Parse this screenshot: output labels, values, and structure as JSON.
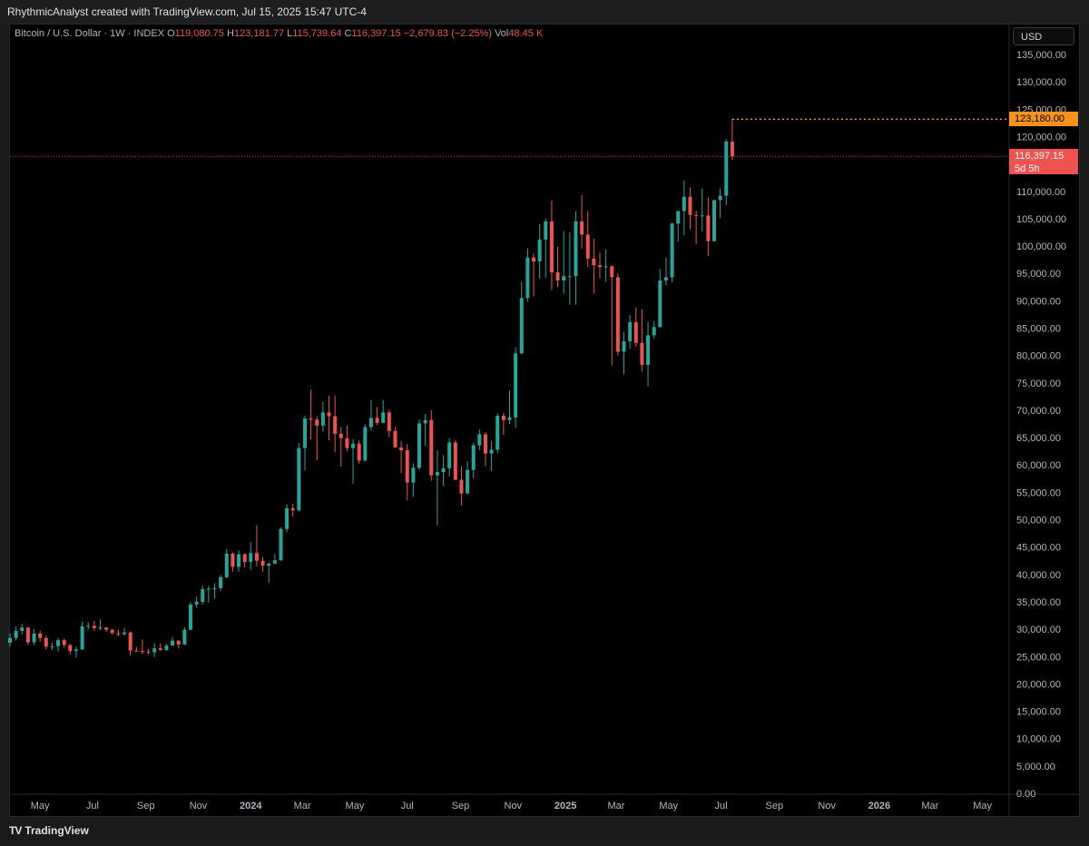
{
  "header": {
    "attribution": "RhythmicAnalyst created with TradingView.com, Jul 15, 2025 15:47 UTC-4"
  },
  "legend": {
    "symbol": "Bitcoin / U.S. Dollar · 1W · INDEX",
    "open_key": "O",
    "open": "119,080.75",
    "high_key": "H",
    "high": "123,181.77",
    "low_key": "L",
    "low": "115,739.64",
    "close_key": "C",
    "close": "116,397.15",
    "change": "−2,679.83 (−2.25%)",
    "vol_key": "Vol",
    "vol": "48.45 K"
  },
  "currency": "USD",
  "high_label": "123,180.00",
  "last_price_label": "116,397.15",
  "countdown_label": "5d 5h",
  "brand": "TradingView",
  "colors": {
    "up": "#26a69a",
    "down": "#ef5350",
    "high_line": "#f7931a",
    "last_line": "#ef5350"
  },
  "chart_data": {
    "type": "candlestick",
    "interval": "1W",
    "ylim": [
      0,
      137000
    ],
    "y_ticks": [
      "0.00",
      "5,000.00",
      "10,000.00",
      "15,000.00",
      "20,000.00",
      "25,000.00",
      "30,000.00",
      "35,000.00",
      "40,000.00",
      "45,000.00",
      "50,000.00",
      "55,000.00",
      "60,000.00",
      "65,000.00",
      "70,000.00",
      "75,000.00",
      "80,000.00",
      "85,000.00",
      "90,000.00",
      "95,000.00",
      "100,000.00",
      "105,000.00",
      "110,000.00",
      "115,000.00",
      "120,000.00",
      "125,000.00",
      "130,000.00",
      "135,000.00"
    ],
    "x_ticks": [
      {
        "label": "May",
        "date": "2023-05-01"
      },
      {
        "label": "Jul",
        "date": "2023-07-01"
      },
      {
        "label": "Sep",
        "date": "2023-09-01"
      },
      {
        "label": "Nov",
        "date": "2023-11-01"
      },
      {
        "label": "2024",
        "date": "2024-01-01",
        "bold": true
      },
      {
        "label": "Mar",
        "date": "2024-03-01"
      },
      {
        "label": "May",
        "date": "2024-05-01"
      },
      {
        "label": "Jul",
        "date": "2024-07-01"
      },
      {
        "label": "Sep",
        "date": "2024-09-01"
      },
      {
        "label": "Nov",
        "date": "2024-11-01"
      },
      {
        "label": "2025",
        "date": "2025-01-01",
        "bold": true
      },
      {
        "label": "Mar",
        "date": "2025-03-01"
      },
      {
        "label": "May",
        "date": "2025-05-01"
      },
      {
        "label": "Jul",
        "date": "2025-07-01"
      },
      {
        "label": "Sep",
        "date": "2025-09-01"
      },
      {
        "label": "Nov",
        "date": "2025-11-01"
      },
      {
        "label": "2026",
        "date": "2026-01-01",
        "bold": true
      },
      {
        "label": "Mar",
        "date": "2026-03-01"
      },
      {
        "label": "May",
        "date": "2026-05-01"
      }
    ],
    "high_marker": 123181.77,
    "last_price": 116397.15,
    "ohlc": [
      [
        "2023-03-27",
        27500,
        29200,
        26800,
        28400
      ],
      [
        "2023-04-03",
        28400,
        30500,
        27900,
        29700
      ],
      [
        "2023-04-10",
        29700,
        31000,
        29000,
        30300
      ],
      [
        "2023-04-17",
        30300,
        30400,
        27200,
        27600
      ],
      [
        "2023-04-24",
        27600,
        30000,
        27100,
        29200
      ],
      [
        "2023-05-01",
        29200,
        29700,
        27700,
        28400
      ],
      [
        "2023-05-08",
        28400,
        28800,
        26300,
        26800
      ],
      [
        "2023-05-15",
        26800,
        27500,
        26200,
        26900
      ],
      [
        "2023-05-22",
        26900,
        28400,
        25900,
        28000
      ],
      [
        "2023-05-29",
        28000,
        28300,
        26600,
        27100
      ],
      [
        "2023-06-05",
        27100,
        27300,
        25400,
        26000
      ],
      [
        "2023-06-12",
        26000,
        26800,
        24800,
        26300
      ],
      [
        "2023-06-19",
        26300,
        31400,
        26200,
        30500
      ],
      [
        "2023-06-26",
        30500,
        31300,
        29900,
        30600
      ],
      [
        "2023-07-03",
        30600,
        31500,
        29700,
        30200
      ],
      [
        "2023-07-10",
        30200,
        31800,
        29800,
        30300
      ],
      [
        "2023-07-17",
        30300,
        30400,
        29500,
        29900
      ],
      [
        "2023-07-24",
        29900,
        30000,
        29000,
        29300
      ],
      [
        "2023-07-31",
        29300,
        29900,
        28700,
        29100
      ],
      [
        "2023-08-07",
        29100,
        30200,
        28800,
        29400
      ],
      [
        "2023-08-14",
        29400,
        29600,
        25200,
        26100
      ],
      [
        "2023-08-21",
        26100,
        26800,
        25800,
        26000
      ],
      [
        "2023-08-28",
        26000,
        28100,
        25400,
        25900
      ],
      [
        "2023-09-04",
        25900,
        26400,
        25400,
        25800
      ],
      [
        "2023-09-11",
        25800,
        27400,
        24900,
        26500
      ],
      [
        "2023-09-18",
        26500,
        27400,
        26000,
        26200
      ],
      [
        "2023-09-25",
        26200,
        27300,
        26000,
        27000
      ],
      [
        "2023-10-02",
        27000,
        28600,
        27200,
        27900
      ],
      [
        "2023-10-09",
        27900,
        28000,
        26500,
        27200
      ],
      [
        "2023-10-16",
        27200,
        30300,
        27100,
        29900
      ],
      [
        "2023-10-23",
        29900,
        35000,
        29800,
        34500
      ],
      [
        "2023-10-30",
        34500,
        35900,
        33900,
        35000
      ],
      [
        "2023-11-06",
        35000,
        38000,
        34500,
        37300
      ],
      [
        "2023-11-13",
        37300,
        37900,
        34800,
        37400
      ],
      [
        "2023-11-20",
        37400,
        38400,
        35600,
        37500
      ],
      [
        "2023-11-27",
        37500,
        39900,
        37000,
        39500
      ],
      [
        "2023-12-04",
        39500,
        44700,
        39300,
        43800
      ],
      [
        "2023-12-11",
        43800,
        44000,
        40500,
        41400
      ],
      [
        "2023-12-18",
        41400,
        44400,
        40500,
        43700
      ],
      [
        "2023-12-25",
        43700,
        43800,
        41300,
        42300
      ],
      [
        "2024-01-01",
        42300,
        45900,
        40800,
        43900
      ],
      [
        "2024-01-08",
        43900,
        49000,
        41500,
        42500
      ],
      [
        "2024-01-15",
        42500,
        43200,
        40500,
        41600
      ],
      [
        "2024-01-22",
        41600,
        42200,
        38500,
        42000
      ],
      [
        "2024-01-29",
        42000,
        43700,
        41800,
        42600
      ],
      [
        "2024-02-05",
        42600,
        48600,
        42500,
        48300
      ],
      [
        "2024-02-12",
        48300,
        52800,
        47700,
        52100
      ],
      [
        "2024-02-19",
        52100,
        52900,
        50600,
        51700
      ],
      [
        "2024-02-26",
        51700,
        64000,
        51500,
        63100
      ],
      [
        "2024-03-04",
        63100,
        69000,
        59000,
        68500
      ],
      [
        "2024-03-11",
        68500,
        73800,
        64600,
        68300
      ],
      [
        "2024-03-18",
        68300,
        68900,
        60800,
        67200
      ],
      [
        "2024-03-25",
        67200,
        71600,
        66100,
        69600
      ],
      [
        "2024-04-01",
        69600,
        72700,
        64500,
        68900
      ],
      [
        "2024-04-08",
        68900,
        72700,
        62300,
        65700
      ],
      [
        "2024-04-15",
        65700,
        66900,
        59700,
        64900
      ],
      [
        "2024-04-22",
        64900,
        67200,
        62500,
        63100
      ],
      [
        "2024-04-29",
        63100,
        64700,
        56600,
        63900
      ],
      [
        "2024-05-06",
        63900,
        64500,
        60200,
        60800
      ],
      [
        "2024-05-13",
        60800,
        67400,
        60700,
        66900
      ],
      [
        "2024-05-20",
        66900,
        71900,
        66300,
        68600
      ],
      [
        "2024-05-27",
        68600,
        70600,
        67300,
        67700
      ],
      [
        "2024-06-03",
        67700,
        71900,
        67600,
        69600
      ],
      [
        "2024-06-10",
        69600,
        70100,
        65100,
        66200
      ],
      [
        "2024-06-17",
        66200,
        66900,
        63400,
        63200
      ],
      [
        "2024-06-24",
        63200,
        64400,
        58500,
        62700
      ],
      [
        "2024-07-01",
        62700,
        63800,
        53500,
        56800
      ],
      [
        "2024-07-08",
        56800,
        60300,
        54200,
        59500
      ],
      [
        "2024-07-15",
        59500,
        68300,
        59100,
        67600
      ],
      [
        "2024-07-22",
        67600,
        69300,
        63500,
        68200
      ],
      [
        "2024-07-29",
        68200,
        70000,
        57100,
        58100
      ],
      [
        "2024-08-05",
        58100,
        62700,
        49000,
        58700
      ],
      [
        "2024-08-12",
        58700,
        61800,
        56100,
        59400
      ],
      [
        "2024-08-19",
        59400,
        64900,
        57900,
        64100
      ],
      [
        "2024-08-26",
        64100,
        64500,
        57200,
        57300
      ],
      [
        "2024-09-02",
        57300,
        59800,
        52600,
        54800
      ],
      [
        "2024-09-09",
        54800,
        60700,
        54600,
        59100
      ],
      [
        "2024-09-16",
        59100,
        64100,
        57500,
        63600
      ],
      [
        "2024-09-23",
        63600,
        66500,
        62700,
        65600
      ],
      [
        "2024-09-30",
        65600,
        66000,
        59800,
        62100
      ],
      [
        "2024-10-07",
        62100,
        64400,
        58900,
        62800
      ],
      [
        "2024-10-14",
        62800,
        69400,
        62100,
        69000
      ],
      [
        "2024-10-21",
        69000,
        69500,
        65500,
        68200
      ],
      [
        "2024-10-28",
        68200,
        73600,
        67500,
        68700
      ],
      [
        "2024-11-04",
        68700,
        81500,
        66800,
        80400
      ],
      [
        "2024-11-11",
        80400,
        93500,
        80200,
        90500
      ],
      [
        "2024-11-18",
        90500,
        99600,
        89800,
        97900
      ],
      [
        "2024-11-25",
        97900,
        98700,
        90800,
        97200
      ],
      [
        "2024-12-02",
        97200,
        104000,
        94000,
        101200
      ],
      [
        "2024-12-09",
        101200,
        105000,
        94200,
        104500
      ],
      [
        "2024-12-16",
        104500,
        108300,
        92000,
        95200
      ],
      [
        "2024-12-23",
        95200,
        99900,
        92500,
        93700
      ],
      [
        "2024-12-30",
        93700,
        102700,
        91300,
        94500
      ],
      [
        "2025-01-06",
        94500,
        102500,
        89300,
        94500
      ],
      [
        "2025-01-13",
        94500,
        106400,
        89300,
        104500
      ],
      [
        "2025-01-20",
        104500,
        109300,
        99500,
        102100
      ],
      [
        "2025-01-27",
        102100,
        106400,
        96200,
        97700
      ],
      [
        "2025-02-03",
        97700,
        101400,
        91300,
        96500
      ],
      [
        "2025-02-10",
        96500,
        98800,
        94100,
        96200
      ],
      [
        "2025-02-17",
        96200,
        99400,
        93400,
        96300
      ],
      [
        "2025-02-24",
        96300,
        96500,
        78200,
        94300
      ],
      [
        "2025-03-03",
        94300,
        95000,
        80000,
        80700
      ],
      [
        "2025-03-10",
        80700,
        84300,
        76600,
        82600
      ],
      [
        "2025-03-17",
        82600,
        87400,
        81200,
        86100
      ],
      [
        "2025-03-24",
        86100,
        88800,
        81600,
        82300
      ],
      [
        "2025-03-31",
        82300,
        88500,
        77100,
        78300
      ],
      [
        "2025-04-07",
        78300,
        86100,
        74400,
        83700
      ],
      [
        "2025-04-14",
        83700,
        86300,
        83100,
        85200
      ],
      [
        "2025-04-21",
        85200,
        95800,
        85100,
        93700
      ],
      [
        "2025-04-28",
        93700,
        97900,
        92800,
        94300
      ],
      [
        "2025-05-05",
        94300,
        104300,
        93400,
        104100
      ],
      [
        "2025-05-12",
        104100,
        105800,
        100800,
        106400
      ],
      [
        "2025-05-19",
        106400,
        112000,
        102000,
        109000
      ],
      [
        "2025-05-26",
        109000,
        110700,
        103100,
        105700
      ],
      [
        "2025-06-02",
        105700,
        106500,
        100400,
        105600
      ],
      [
        "2025-06-09",
        105600,
        110500,
        102700,
        105600
      ],
      [
        "2025-06-16",
        105600,
        108900,
        98200,
        100900
      ],
      [
        "2025-06-23",
        100900,
        108300,
        100800,
        108400
      ],
      [
        "2025-06-30",
        108400,
        110500,
        105100,
        109200
      ],
      [
        "2025-07-07",
        109200,
        119500,
        107500,
        119100
      ],
      [
        "2025-07-14",
        119080.75,
        123181.77,
        115739.64,
        116397.15
      ]
    ]
  }
}
